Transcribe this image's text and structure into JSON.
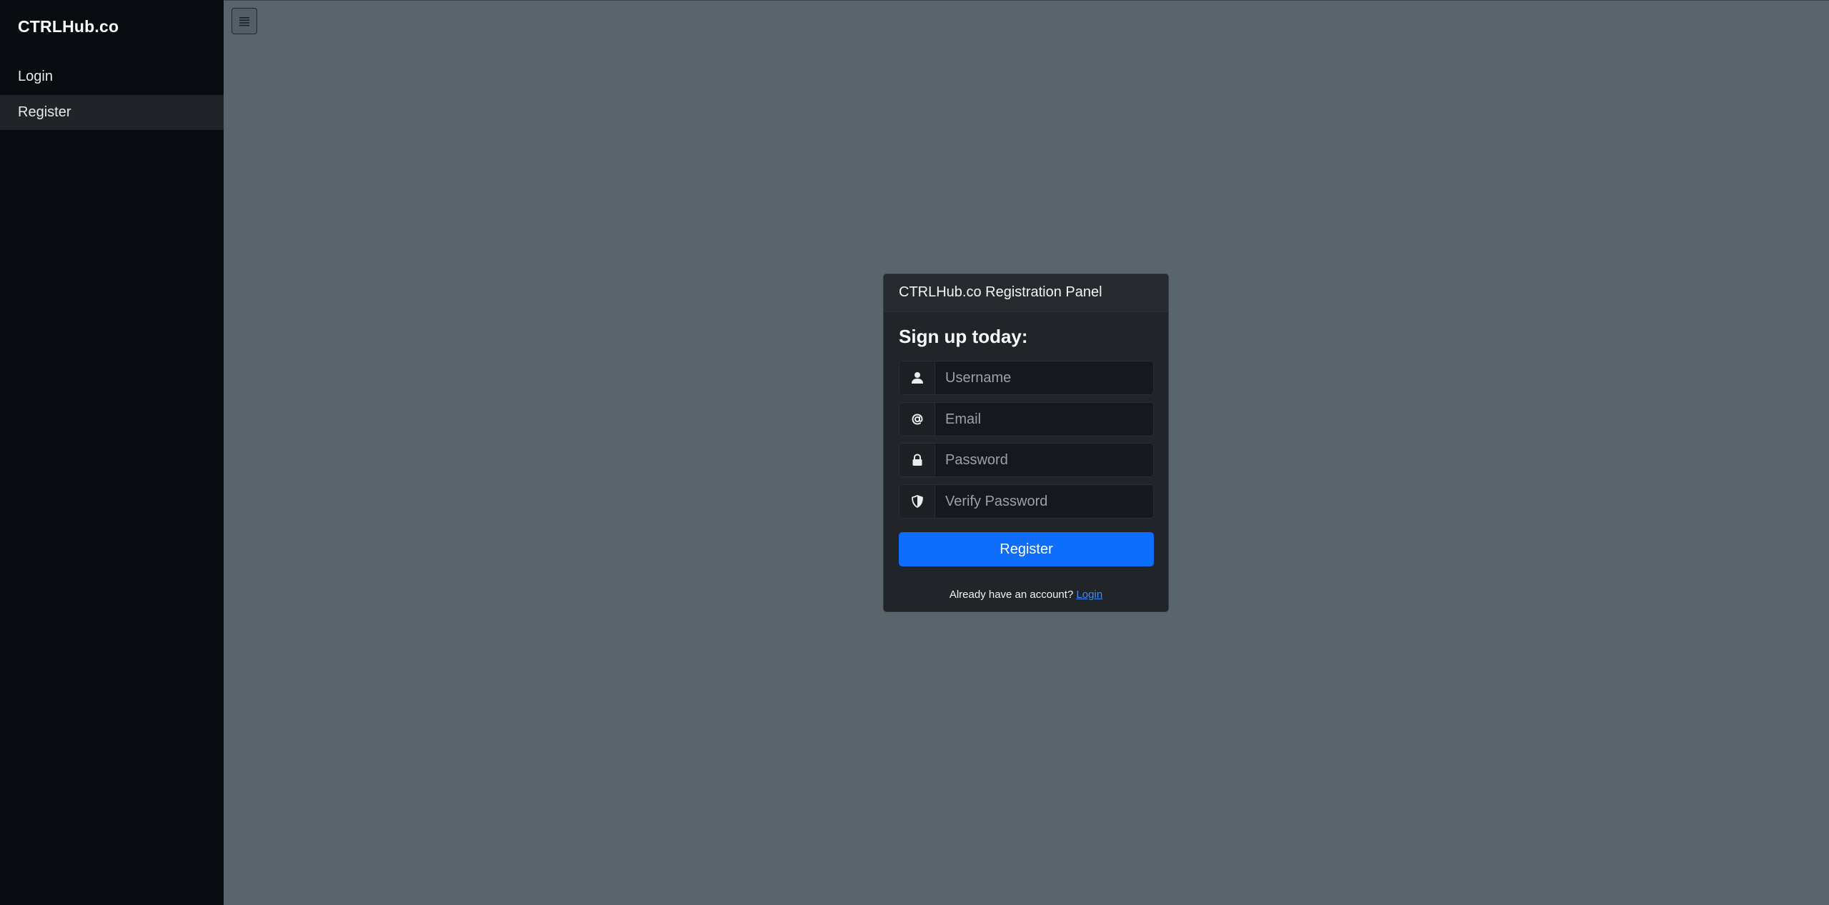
{
  "sidebar": {
    "brand": "CTRLHub.co",
    "items": [
      {
        "label": "Login",
        "active": false
      },
      {
        "label": "Register",
        "active": true
      }
    ]
  },
  "toolbar": {
    "toggle_icon": "list-icon"
  },
  "panel": {
    "title": "CTRLHub.co Registration Panel",
    "heading": "Sign up today:",
    "fields": {
      "username": {
        "icon": "user-icon",
        "placeholder": "Username",
        "value": ""
      },
      "email": {
        "icon": "at-icon",
        "placeholder": "Email",
        "value": ""
      },
      "password": {
        "icon": "lock-icon",
        "placeholder": "Password",
        "value": ""
      },
      "verify_password": {
        "icon": "shield-icon",
        "placeholder": "Verify Password",
        "value": ""
      }
    },
    "register_label": "Register",
    "footer_text": "Already have an account?",
    "footer_link": "Login"
  },
  "colors": {
    "accent": "#0d6efd",
    "link": "#3d8bfd",
    "sidebar_bg": "#080c10",
    "page_bg": "#5a646d",
    "card_bg": "#212529"
  }
}
